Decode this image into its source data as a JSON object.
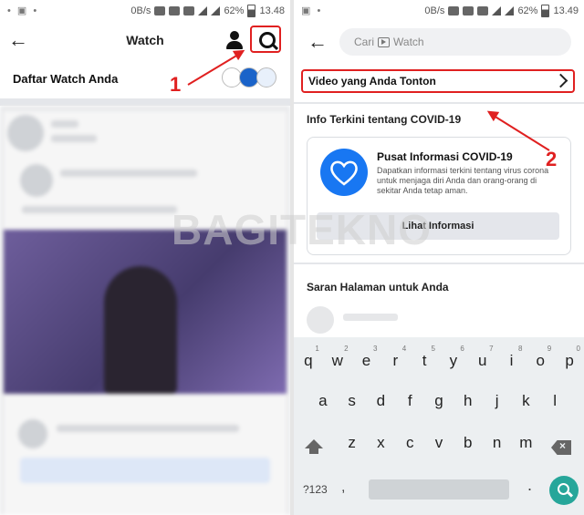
{
  "left": {
    "status": {
      "net": "0B/s",
      "battery": "62%",
      "time": "13.48"
    },
    "header": {
      "title": "Watch"
    },
    "watchlist": {
      "label": "Daftar Watch Anda"
    },
    "annotation": {
      "number": "1"
    }
  },
  "right": {
    "status": {
      "net": "0B/s",
      "battery": "62%",
      "time": "13.49"
    },
    "search": {
      "prefix": "Cari",
      "suffix": "Watch"
    },
    "watched": {
      "label": "Video yang Anda Tonton"
    },
    "covid_section": {
      "heading": "Info Terkini tentang COVID-19"
    },
    "covid_card": {
      "title": "Pusat Informasi COVID-19",
      "description": "Dapatkan informasi terkini tentang virus corona untuk menjaga diri Anda dan orang-orang di sekitar Anda tetap aman.",
      "button": "Lihat Informasi"
    },
    "suggestions": {
      "heading": "Saran Halaman untuk Anda"
    },
    "annotation": {
      "number": "2"
    },
    "keyboard": {
      "row1": [
        "q",
        "w",
        "e",
        "r",
        "t",
        "y",
        "u",
        "i",
        "o",
        "p"
      ],
      "row1_hints": [
        "1",
        "2",
        "3",
        "4",
        "5",
        "6",
        "7",
        "8",
        "9",
        "0"
      ],
      "row2": [
        "a",
        "s",
        "d",
        "f",
        "g",
        "h",
        "j",
        "k",
        "l"
      ],
      "row3": [
        "z",
        "x",
        "c",
        "v",
        "b",
        "n",
        "m"
      ],
      "num_label": "?123",
      "comma": ",",
      "period": "."
    }
  },
  "watermark": "BAGITEKNO",
  "colors": {
    "annotation": "#e02020",
    "facebook_blue": "#1877f2",
    "keyboard_go": "#26a69a"
  }
}
